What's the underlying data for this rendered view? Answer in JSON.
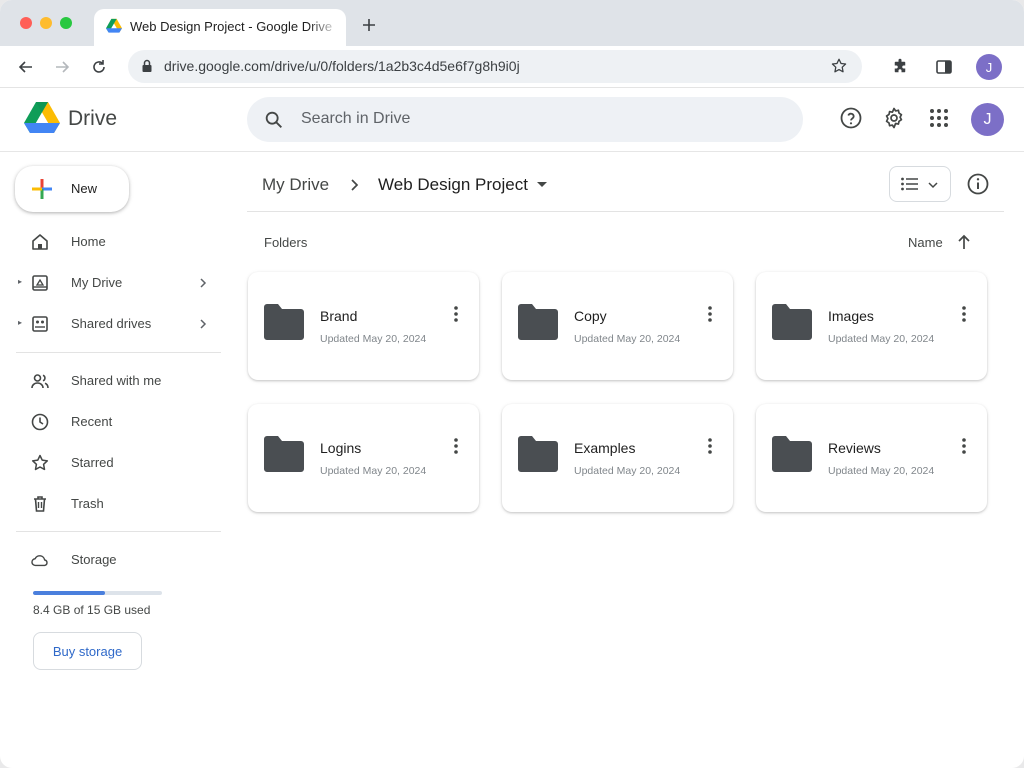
{
  "browser": {
    "tab_title": "Web Design Project - Google Drive",
    "url": "drive.google.com/drive/u/0/folders/1a2b3c4d5e6f7g8h9i0j",
    "profile_initial": "J"
  },
  "header": {
    "app_name": "Drive",
    "search_placeholder": "Search in Drive",
    "avatar_initial": "J"
  },
  "sidebar": {
    "new_label": "New",
    "items": [
      {
        "label": "Home",
        "icon": "home-icon"
      },
      {
        "label": "My Drive",
        "icon": "my-drive-icon"
      },
      {
        "label": "Shared drives",
        "icon": "shared-drives-icon"
      },
      {
        "label": "Shared with me",
        "icon": "people-icon"
      },
      {
        "label": "Recent",
        "icon": "clock-icon"
      },
      {
        "label": "Starred",
        "icon": "star-icon"
      },
      {
        "label": "Trash",
        "icon": "trash-icon"
      },
      {
        "label": "Storage",
        "icon": "cloud-icon"
      }
    ],
    "storage_used_fraction": 0.56,
    "storage_text": "8.4 GB of 15 GB used",
    "buy_storage": "Buy storage"
  },
  "main": {
    "breadcrumb_root": "My Drive",
    "breadcrumb_current": "Web Design Project",
    "section_label": "Folders",
    "sort_label": "Name",
    "folders": [
      {
        "name": "Brand",
        "meta": "Updated May 20, 2024"
      },
      {
        "name": "Copy",
        "meta": "Updated May 20, 2024"
      },
      {
        "name": "Images",
        "meta": "Updated May 20, 2024"
      },
      {
        "name": "Logins",
        "meta": "Updated May 20, 2024"
      },
      {
        "name": "Examples",
        "meta": "Updated May 20, 2024"
      },
      {
        "name": "Reviews",
        "meta": "Updated May 20, 2024"
      }
    ]
  },
  "colors": {
    "accent": "#1a73e8",
    "folder": "#4a4e52",
    "avatar": "#7c6fc7"
  }
}
